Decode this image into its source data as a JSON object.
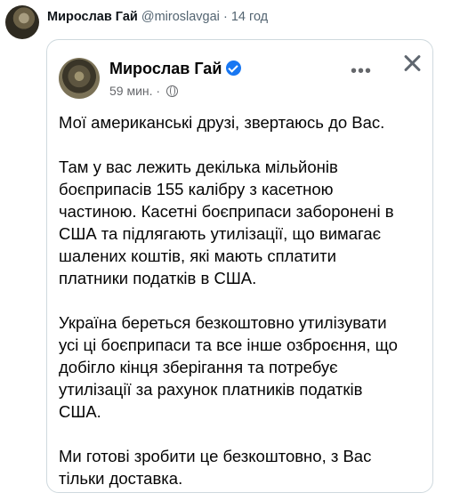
{
  "tweet": {
    "author_name": "Мирослав Гай",
    "handle": "@miroslavgai",
    "separator": "·",
    "time": "14 год"
  },
  "fb_post": {
    "author_name": "Мирослав Гай",
    "time": "59 мин.",
    "separator": "·",
    "verified": true,
    "icons": {
      "verified": "verified-badge-icon",
      "audience": "globe-icon",
      "more": "more-horizontal-icon",
      "close": "close-icon"
    },
    "accent_color": "#1877f2",
    "paragraphs": [
      "Мої американські друзі, звертаюсь до Вас.",
      "Там у вас лежить декілька мільйонів\nбоєприпасів 155 калібру з касетною\nчастиною. Касетні боєприпаси заборонені в\nСША та підлягають утилізації, що вимагає\nшалених коштів, які мають сплатити\nплатники податків в США.",
      " Україна береться безкоштовно утилізувати\nусі ці боєприпаси та все інше озброєння, що\nдобігло кінця зберігання та потребує\nутилізації за рахунок платників податків\nСША.",
      "Ми готові зробити це безкоштовно, з Вас\nтільки доставка."
    ]
  }
}
